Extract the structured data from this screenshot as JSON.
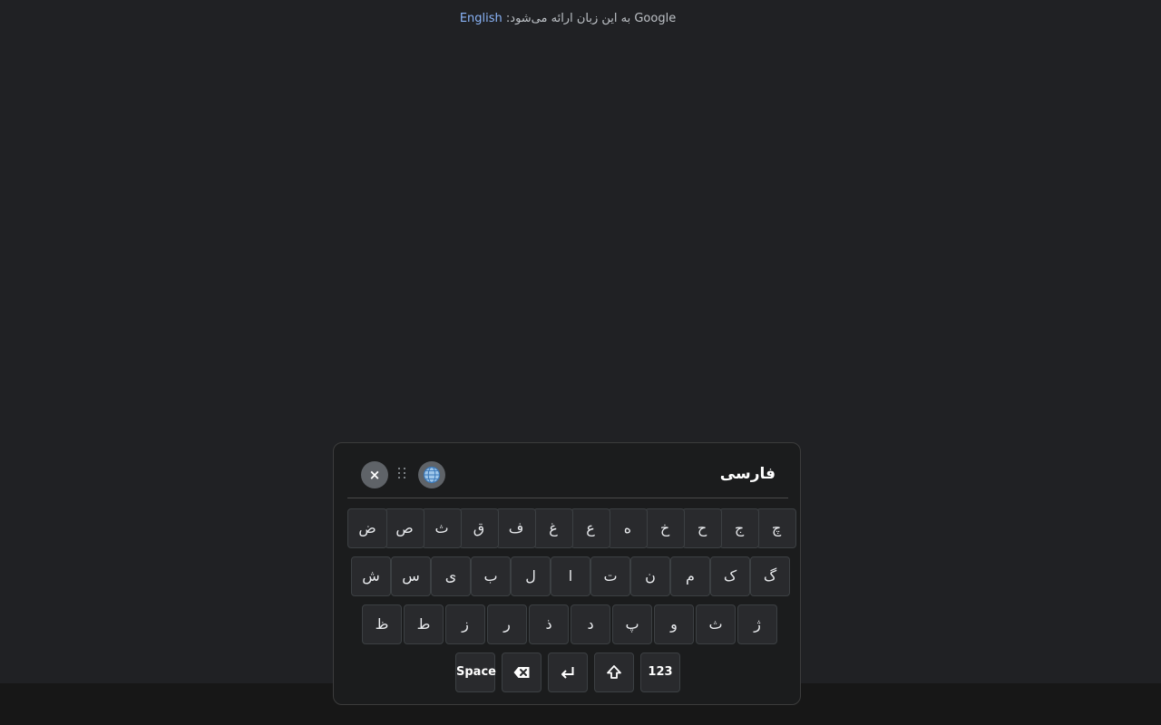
{
  "language_offer": {
    "text": "Google به این زبان ارائه می‌شود: ",
    "link_label": "English"
  },
  "keyboard": {
    "title": "فارسی",
    "close_label": "×",
    "icons": {
      "close": "close-icon",
      "drag": "drag-handle-icon",
      "language": "globe-icon",
      "backspace": "backspace-icon",
      "enter": "enter-icon",
      "shift": "shift-icon"
    },
    "row1": [
      "چ",
      "ج",
      "ح",
      "خ",
      "ه",
      "ع",
      "غ",
      "ف",
      "ق",
      "ث",
      "ص",
      "ض"
    ],
    "row2": [
      "گ",
      "ک",
      "م",
      "ن",
      "ت",
      "ا",
      "ل",
      "ب",
      "ی",
      "س",
      "ش"
    ],
    "row3": [
      "ژ",
      "ث",
      "و",
      "پ",
      "د",
      "ذ",
      "ر",
      "ز",
      "ط",
      "ظ"
    ],
    "bottom": {
      "numbers_label": "123",
      "space_label": "Space"
    }
  },
  "colors": {
    "background": "#202124",
    "key_background": "#292a2d",
    "link": "#8ab4f8"
  }
}
